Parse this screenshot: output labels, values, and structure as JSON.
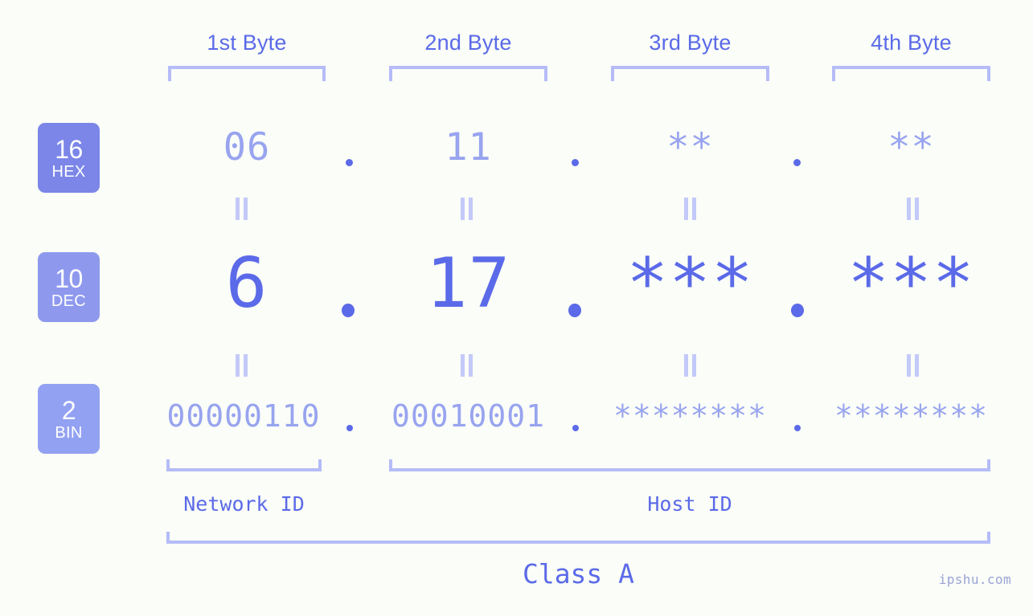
{
  "watermark": "ipshu.com",
  "colors": {
    "background": "#fafdf8",
    "accent_strong": "#5b6ae8",
    "accent_light": "#98a4ef",
    "bracket": "#b5bcf7",
    "badge_hex": "#7b86e8",
    "badge_dec": "#8e99ee",
    "badge_bin": "#93a1f2"
  },
  "byte_headers": [
    {
      "label": "1st Byte"
    },
    {
      "label": "2nd Byte"
    },
    {
      "label": "3rd Byte"
    },
    {
      "label": "4th Byte"
    }
  ],
  "rows": [
    {
      "badge_number": "16",
      "badge_name": "HEX",
      "values": [
        "06",
        "11",
        "**",
        "**"
      ],
      "separator": "."
    },
    {
      "badge_number": "10",
      "badge_name": "DEC",
      "values": [
        "6",
        "17",
        "***",
        "***"
      ],
      "separator": "."
    },
    {
      "badge_number": "2",
      "badge_name": "BIN",
      "values": [
        "00000110",
        "00010001",
        "********",
        "********"
      ],
      "separator": "."
    }
  ],
  "equals_sign": "=",
  "segments": {
    "network_id": "Network ID",
    "host_id": "Host ID"
  },
  "class": "Class A"
}
